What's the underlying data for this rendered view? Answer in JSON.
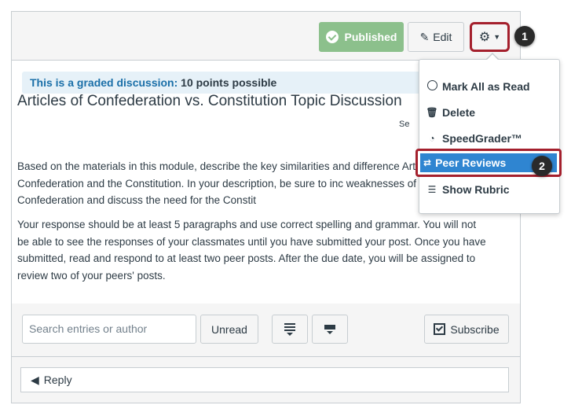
{
  "toolbar": {
    "published_label": "Published",
    "edit_label": "Edit"
  },
  "notice": {
    "prefix": "This is a graded discussion:",
    "points": "10 points possible"
  },
  "topic": {
    "title": "Articles of Confederation vs. Constitution Topic Discussion",
    "truncated_meta": "Se",
    "paragraph1": "Based on the materials in this module, describe the key similarities and difference Articles of Confederation and the Constitution. In your description, be sure to inc weaknesses of the Articles of Confederation and discuss the need for the Constit",
    "paragraph2": "Your response should be at least 5 paragraphs and use correct spelling and grammar. You will not be able to see the responses of your classmates until you have submitted your post. Once you have submitted, read and respond to at least two peer posts. After the due date, you will be assigned to review two of your peers' posts."
  },
  "filters": {
    "search_placeholder": "Search entries or author",
    "unread_label": "Unread",
    "subscribe_label": "Subscribe"
  },
  "reply": {
    "label": "Reply"
  },
  "menu": {
    "items": [
      {
        "label": "Mark All as Read",
        "icon": "circle-icon"
      },
      {
        "label": "Delete",
        "icon": "trash-icon"
      },
      {
        "label": "SpeedGrader™",
        "icon": "speedgrader-icon"
      },
      {
        "label": "Peer Reviews",
        "icon": "peer-review-icon"
      },
      {
        "label": "Show Rubric",
        "icon": "rubric-icon"
      }
    ]
  },
  "callouts": [
    "1",
    "2"
  ],
  "colors": {
    "published": "#8cc08c",
    "highlight": "#a4202d",
    "selected": "#2f85d1",
    "notice_bg": "#e6f1f8",
    "notice_text": "#1a6fa8"
  }
}
